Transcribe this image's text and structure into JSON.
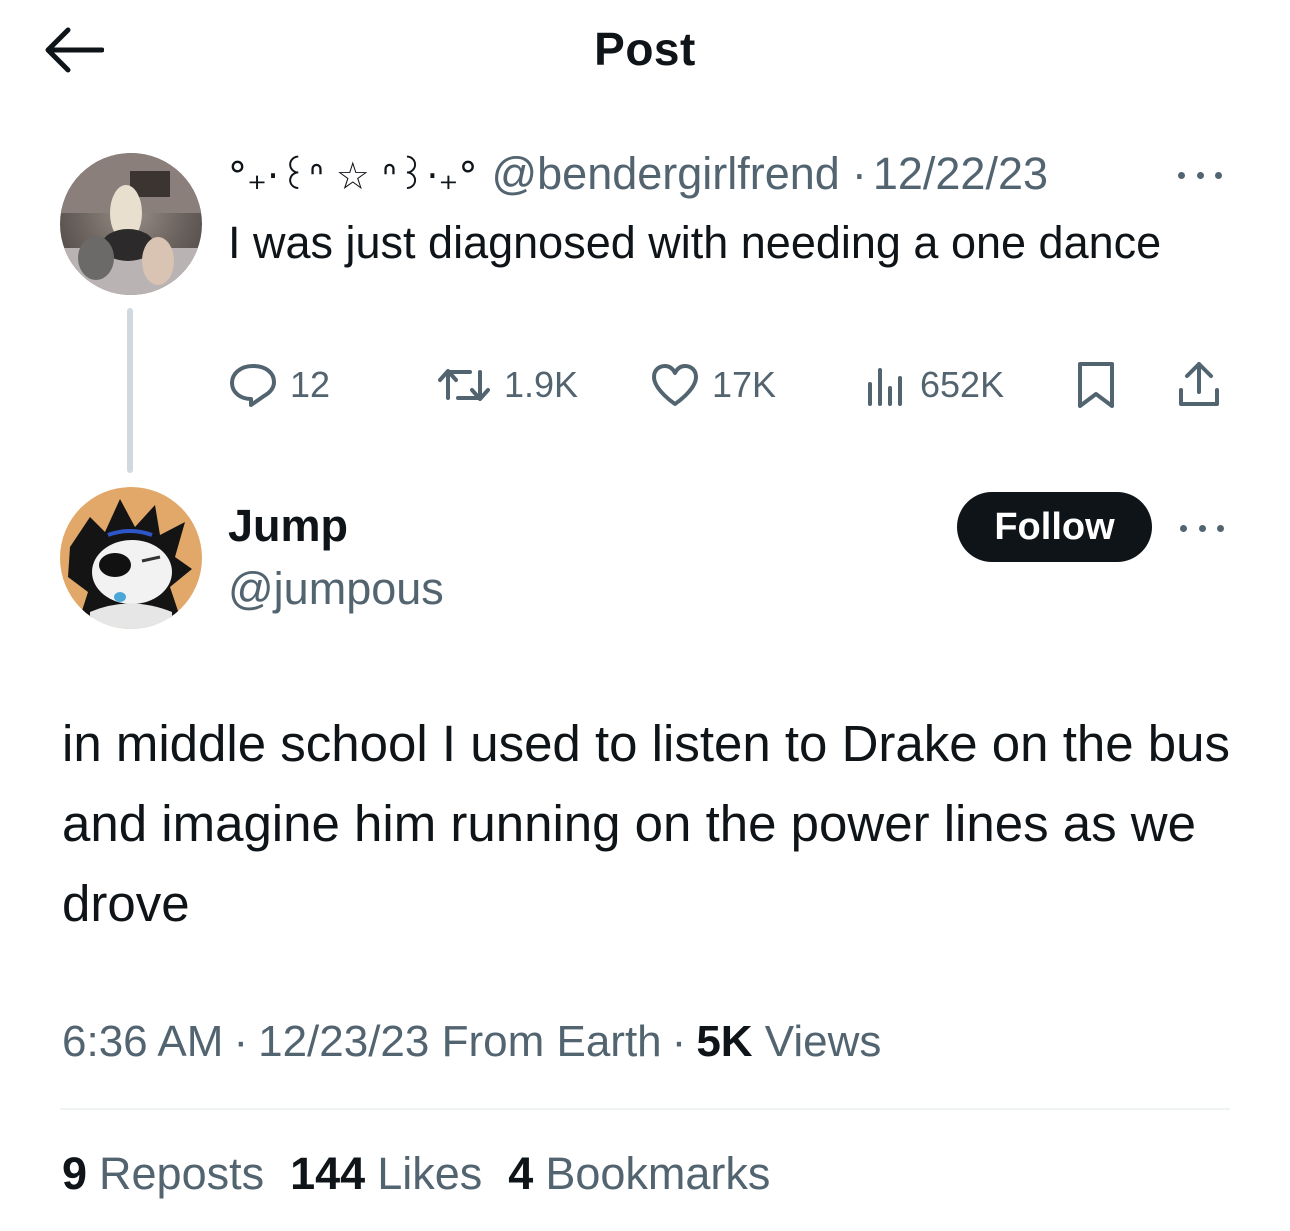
{
  "header": {
    "title": "Post",
    "back_icon": "arrow-left-icon"
  },
  "parent_post": {
    "display_name": "°₊·꒰ᐢ ☆ ᐢ꒱·₊°",
    "handle": "@bendergirlfrend",
    "separator": "·",
    "date": "12/22/23",
    "text": "I was just diagnosed with needing a one dance",
    "metrics": {
      "replies": "12",
      "reposts": "1.9K",
      "likes": "17K",
      "views": "652K"
    }
  },
  "post": {
    "display_name": "Jump",
    "handle": "@jumpous",
    "follow_label": "Follow",
    "text": "in middle school I used to listen to Drake on the bus and imagine him running on the power lines as we drove",
    "time": "6:36 AM",
    "separator": "·",
    "date": "12/23/23",
    "location": "From Earth",
    "views_count": "5K",
    "views_label": "Views",
    "stats": {
      "reposts_count": "9",
      "reposts_label": "Reposts",
      "likes_count": "144",
      "likes_label": "Likes",
      "bookmarks_count": "4",
      "bookmarks_label": "Bookmarks"
    }
  },
  "colors": {
    "text_primary": "#0f1419",
    "text_secondary": "#536471",
    "thread_line": "#cfd9de",
    "divider": "#eff3f4",
    "follow_bg": "#0f1419"
  }
}
